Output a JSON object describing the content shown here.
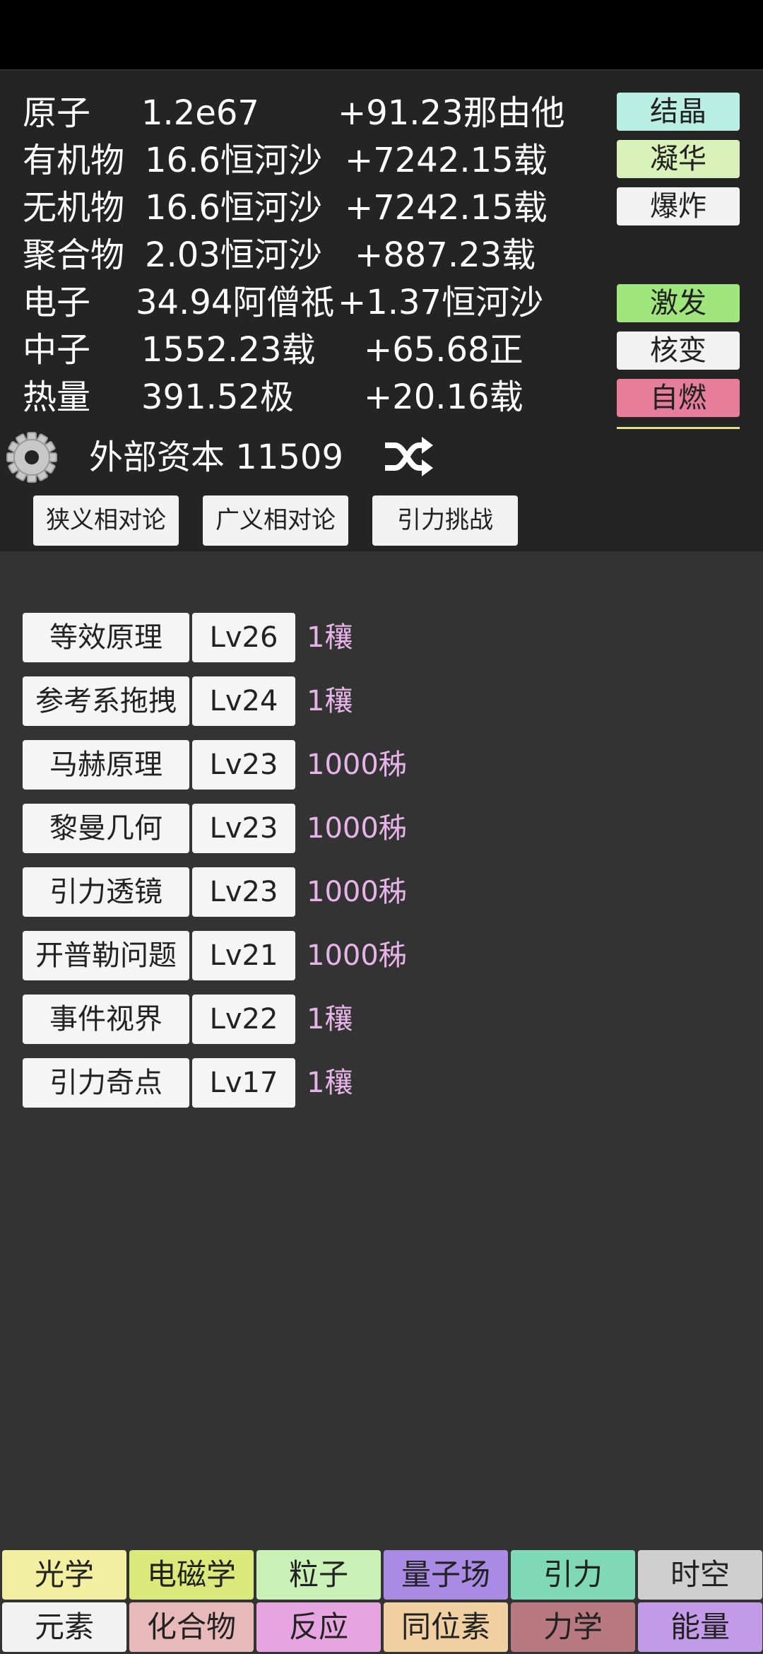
{
  "resources": [
    {
      "name": "原子",
      "amount": "1.2e67",
      "rate": "+91.23那由他"
    },
    {
      "name": "有机物",
      "amount": "16.6恒河沙",
      "rate": "+7242.15载"
    },
    {
      "name": "无机物",
      "amount": "16.6恒河沙",
      "rate": "+7242.15载"
    },
    {
      "name": "聚合物",
      "amount": "2.03恒河沙",
      "rate": "+887.23载"
    },
    {
      "name": "电子",
      "amount": "34.94阿僧祇",
      "rate": "+1.37恒河沙"
    },
    {
      "name": "中子",
      "amount": "1552.23载",
      "rate": "+65.68正"
    },
    {
      "name": "热量",
      "amount": "391.52极",
      "rate": "+20.16载"
    }
  ],
  "actions": [
    {
      "label": "结晶",
      "color": "#b9efe3"
    },
    {
      "label": "凝华",
      "color": "#d9f2b9"
    },
    {
      "label": "爆炸",
      "color": "#f2f2f2"
    },
    {
      "label": "激发",
      "color": "#9fe67d"
    },
    {
      "label": "核变",
      "color": "#f2f2f2"
    },
    {
      "label": "自燃",
      "color": "#e67d9a"
    }
  ],
  "capital": {
    "label": "外部资本",
    "value": "11509"
  },
  "tabs": [
    "狭义相对论",
    "广义相对论",
    "引力挑战"
  ],
  "skills": [
    {
      "name": "等效原理",
      "level": "Lv26",
      "cost": "1穰"
    },
    {
      "name": "参考系拖拽",
      "level": "Lv24",
      "cost": "1穰"
    },
    {
      "name": "马赫原理",
      "level": "Lv23",
      "cost": "1000秭"
    },
    {
      "name": "黎曼几何",
      "level": "Lv23",
      "cost": "1000秭"
    },
    {
      "name": "引力透镜",
      "level": "Lv23",
      "cost": "1000秭"
    },
    {
      "name": "开普勒问题",
      "level": "Lv21",
      "cost": "1000秭"
    },
    {
      "name": "事件视界",
      "level": "Lv22",
      "cost": "1穰"
    },
    {
      "name": "引力奇点",
      "level": "Lv17",
      "cost": "1穰"
    }
  ],
  "nav_row1": [
    {
      "label": "光学",
      "color": "#f2f0a0"
    },
    {
      "label": "电磁学",
      "color": "#d9ea7a"
    },
    {
      "label": "粒子",
      "color": "#c9f0b5"
    },
    {
      "label": "量子场",
      "color": "#a98be6"
    },
    {
      "label": "引力",
      "color": "#7fd8b8"
    },
    {
      "label": "时空",
      "color": "#cfcfcf"
    }
  ],
  "nav_row2": [
    {
      "label": "元素",
      "color": "#f2f2f2"
    },
    {
      "label": "化合物",
      "color": "#e8b9b9"
    },
    {
      "label": "反应",
      "color": "#e6a5e0"
    },
    {
      "label": "同位素",
      "color": "#f0cfa0"
    },
    {
      "label": "力学",
      "color": "#b87a80"
    },
    {
      "label": "能量",
      "color": "#c49be8"
    }
  ]
}
